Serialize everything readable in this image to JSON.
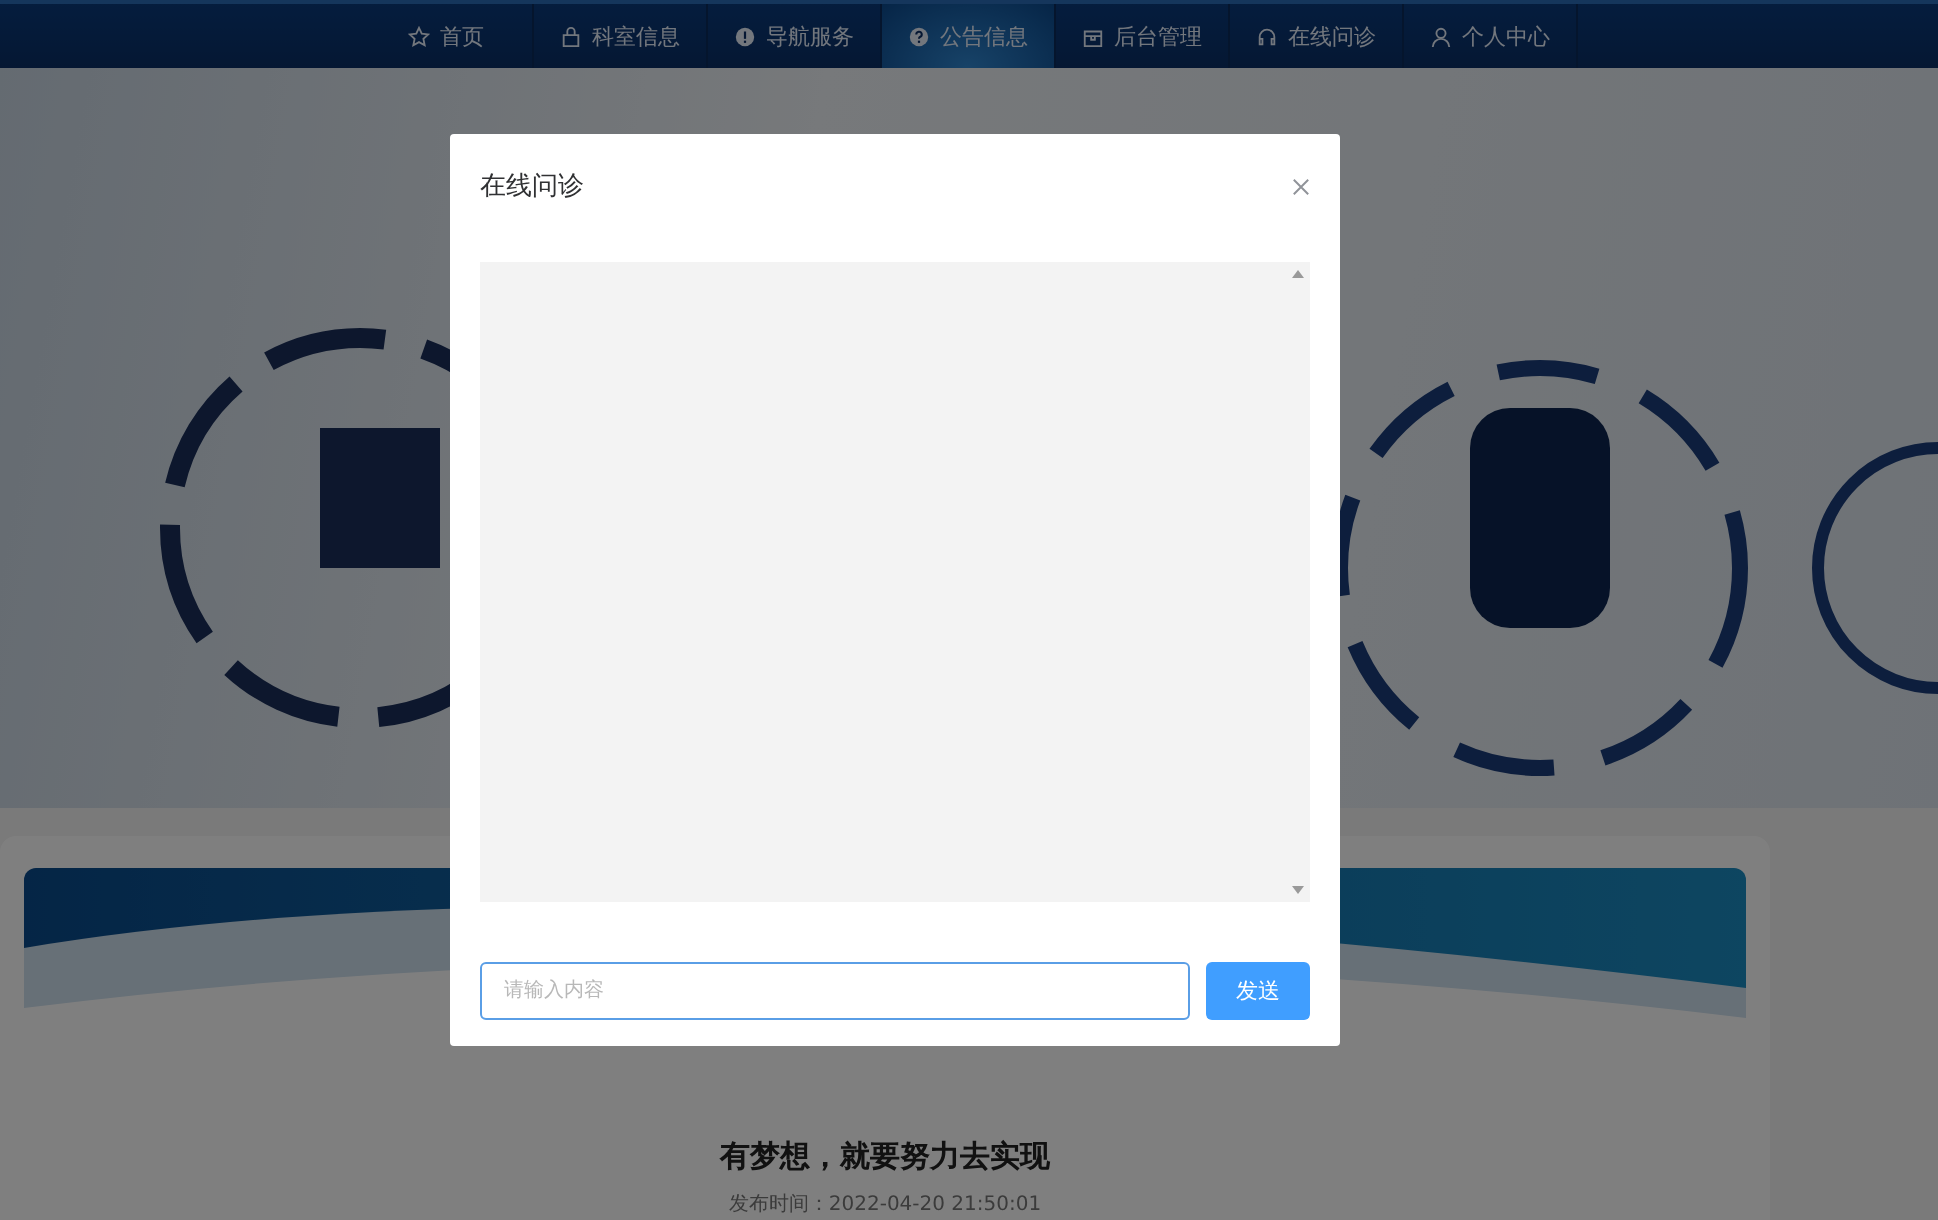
{
  "nav": {
    "items": [
      {
        "label": "首页",
        "selected": false
      },
      {
        "label": "科室信息",
        "selected": false
      },
      {
        "label": "导航服务",
        "selected": false
      },
      {
        "label": "公告信息",
        "selected": true
      },
      {
        "label": "后台管理",
        "selected": false
      },
      {
        "label": "在线问诊",
        "selected": false
      },
      {
        "label": "个人中心",
        "selected": false
      }
    ]
  },
  "article": {
    "title": "有梦想，就要努力去实现",
    "meta": "发布时间：2022-04-20 21:50:01"
  },
  "dialog": {
    "title": "在线问诊",
    "message_input": {
      "placeholder": "请输入内容"
    },
    "send_button": "发送"
  }
}
